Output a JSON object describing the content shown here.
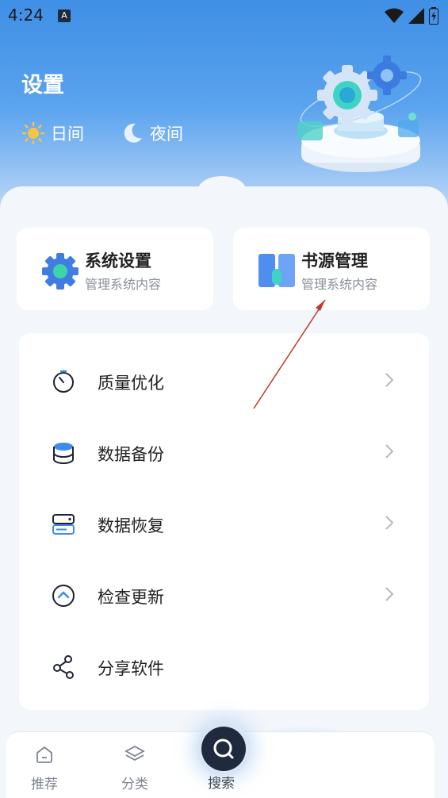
{
  "status_bar": {
    "time": "4:24",
    "notification_badge": "A"
  },
  "header": {
    "title": "设置",
    "modes": [
      {
        "label": "日间",
        "icon": "sun-icon"
      },
      {
        "label": "夜间",
        "icon": "moon-icon"
      }
    ]
  },
  "cards": [
    {
      "title": "系统设置",
      "subtitle": "管理系统内容",
      "icon": "gear-icon"
    },
    {
      "title": "书源管理",
      "subtitle": "管理系统内容",
      "icon": "book-icon"
    }
  ],
  "menu": [
    {
      "label": "质量优化",
      "icon": "timer-icon"
    },
    {
      "label": "数据备份",
      "icon": "database-icon"
    },
    {
      "label": "数据恢复",
      "icon": "server-icon"
    },
    {
      "label": "检查更新",
      "icon": "update-icon"
    },
    {
      "label": "分享软件",
      "icon": "share-icon"
    }
  ],
  "tabs": [
    {
      "label": "推荐",
      "icon": "home-icon"
    },
    {
      "label": "分类",
      "icon": "layers-icon"
    },
    {
      "label": "搜索",
      "icon": "search-icon"
    }
  ],
  "colors": {
    "accent": "#3f8fe6",
    "text": "#222222",
    "muted": "#8a8f99"
  }
}
